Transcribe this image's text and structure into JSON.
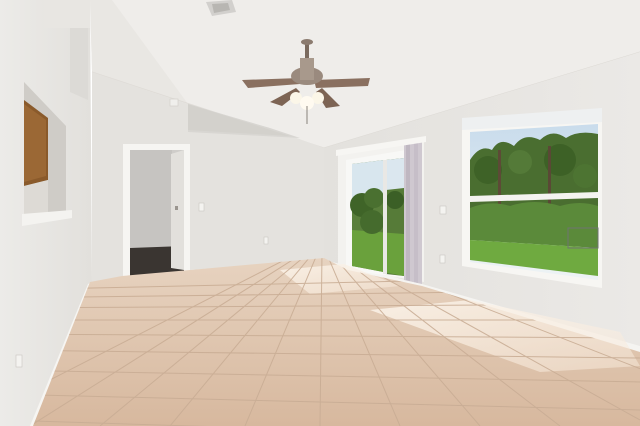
{
  "scene": {
    "subject": "empty-room-interior",
    "features": [
      "ceiling-fan",
      "vaulted-textured-ceiling",
      "tile-floor",
      "sliding-glass-door",
      "picture-window",
      "open-doorway",
      "wall-niche",
      "vertical-blind"
    ]
  },
  "colors": {
    "wall": "#e6e3df",
    "ceiling": "#efedea",
    "floor_tile": "#ddc3ac",
    "grout": "#c9ad95",
    "trim": "#f7f6f3",
    "foliage": "#4d7434",
    "lawn": "#69a23d",
    "sky": "#dbe8f2",
    "fan_blade": "#8a7060",
    "cabinet_wood": "#8a5a2b"
  }
}
